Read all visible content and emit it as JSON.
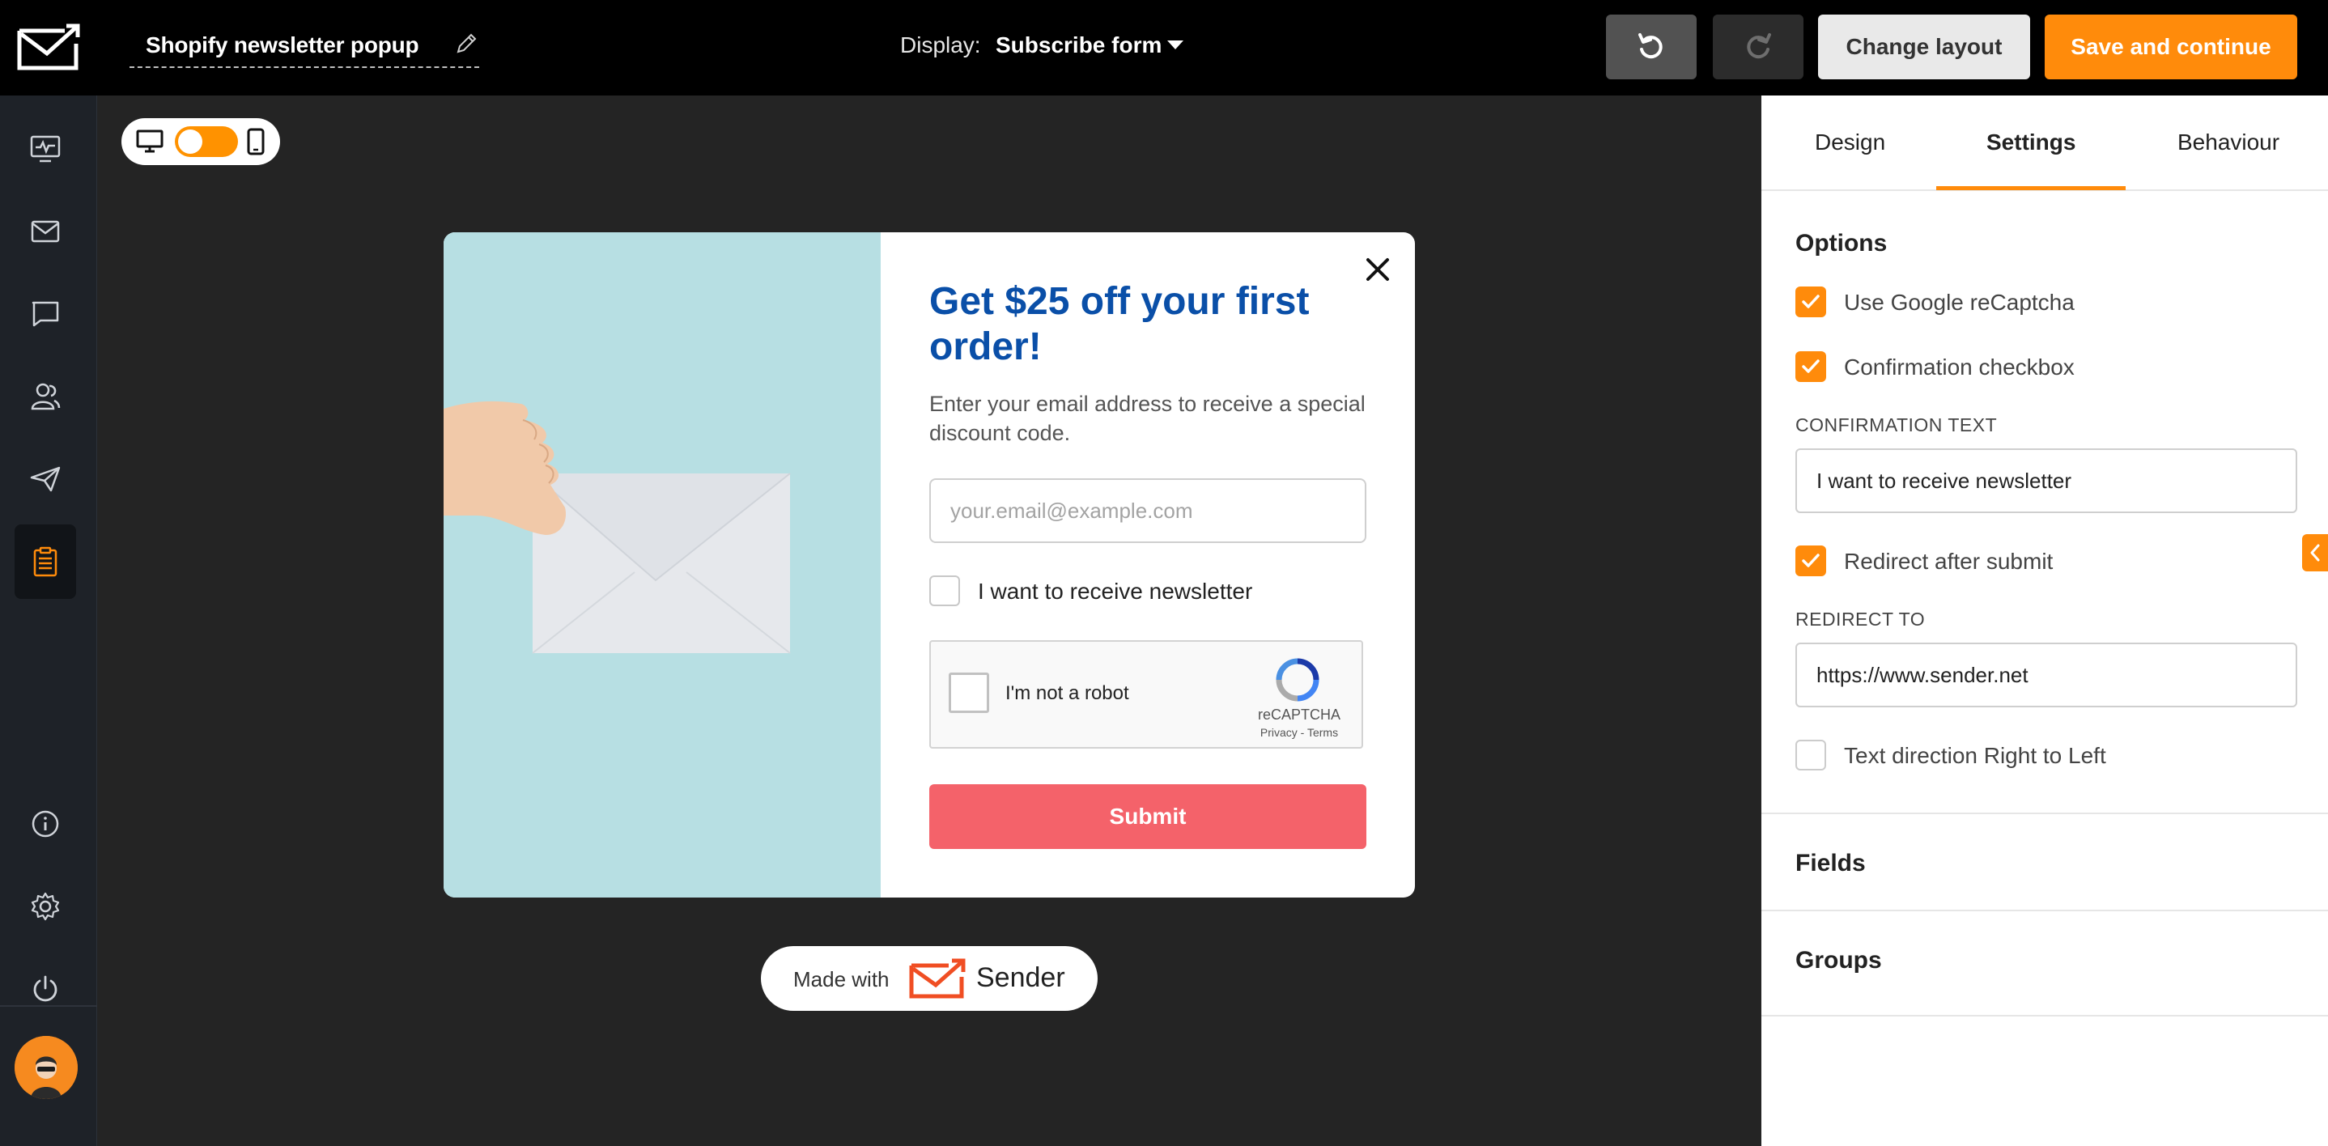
{
  "topbar": {
    "title": "Shopify newsletter popup",
    "display_label": "Display:",
    "display_value": "Subscribe form",
    "change_layout_label": "Change layout",
    "save_label": "Save and continue"
  },
  "sidebar": {
    "items": [
      {
        "name": "dashboard",
        "icon": "monitor-pulse-icon"
      },
      {
        "name": "campaigns",
        "icon": "envelope-icon"
      },
      {
        "name": "sms",
        "icon": "chat-bubble-icon"
      },
      {
        "name": "subscribers",
        "icon": "users-icon"
      },
      {
        "name": "automation",
        "icon": "paper-plane-icon"
      },
      {
        "name": "forms",
        "icon": "clipboard-list-icon",
        "active": true
      }
    ],
    "bottom_items": [
      {
        "name": "info",
        "icon": "info-icon"
      },
      {
        "name": "settings",
        "icon": "gear-icon"
      },
      {
        "name": "logout",
        "icon": "power-icon"
      }
    ]
  },
  "popup": {
    "title": "Get $25 off your first order!",
    "subtitle": "Enter your email address to receive a special discount code.",
    "email_placeholder": "your.email@example.com",
    "checkbox_label": "I want to receive newsletter",
    "recaptcha_label": "I'm not a robot",
    "recaptcha_brand": "reCAPTCHA",
    "recaptcha_links": "Privacy - Terms",
    "submit_label": "Submit"
  },
  "made_with": {
    "text": "Made with",
    "brand": "Sender"
  },
  "panel": {
    "tabs": [
      {
        "label": "Design",
        "active": false
      },
      {
        "label": "Settings",
        "active": true
      },
      {
        "label": "Behaviour",
        "active": false
      }
    ],
    "options_title": "Options",
    "options": {
      "recaptcha": {
        "label": "Use Google reCaptcha",
        "checked": true
      },
      "confirmation": {
        "label": "Confirmation checkbox",
        "checked": true
      },
      "redirect": {
        "label": "Redirect after submit",
        "checked": true
      },
      "rtl": {
        "label": "Text direction Right to Left",
        "checked": false
      }
    },
    "confirmation_text_label": "CONFIRMATION TEXT",
    "confirmation_text_value": "I want to receive newsletter",
    "redirect_to_label": "REDIRECT TO",
    "redirect_to_value": "https://www.sender.net",
    "fields_title": "Fields",
    "groups_title": "Groups"
  },
  "colors": {
    "accent": "#ff8b0b",
    "popup_title": "#0a4fa8",
    "submit": "#f4626a",
    "sidebar": "#1e2228",
    "canvas": "#242424"
  }
}
